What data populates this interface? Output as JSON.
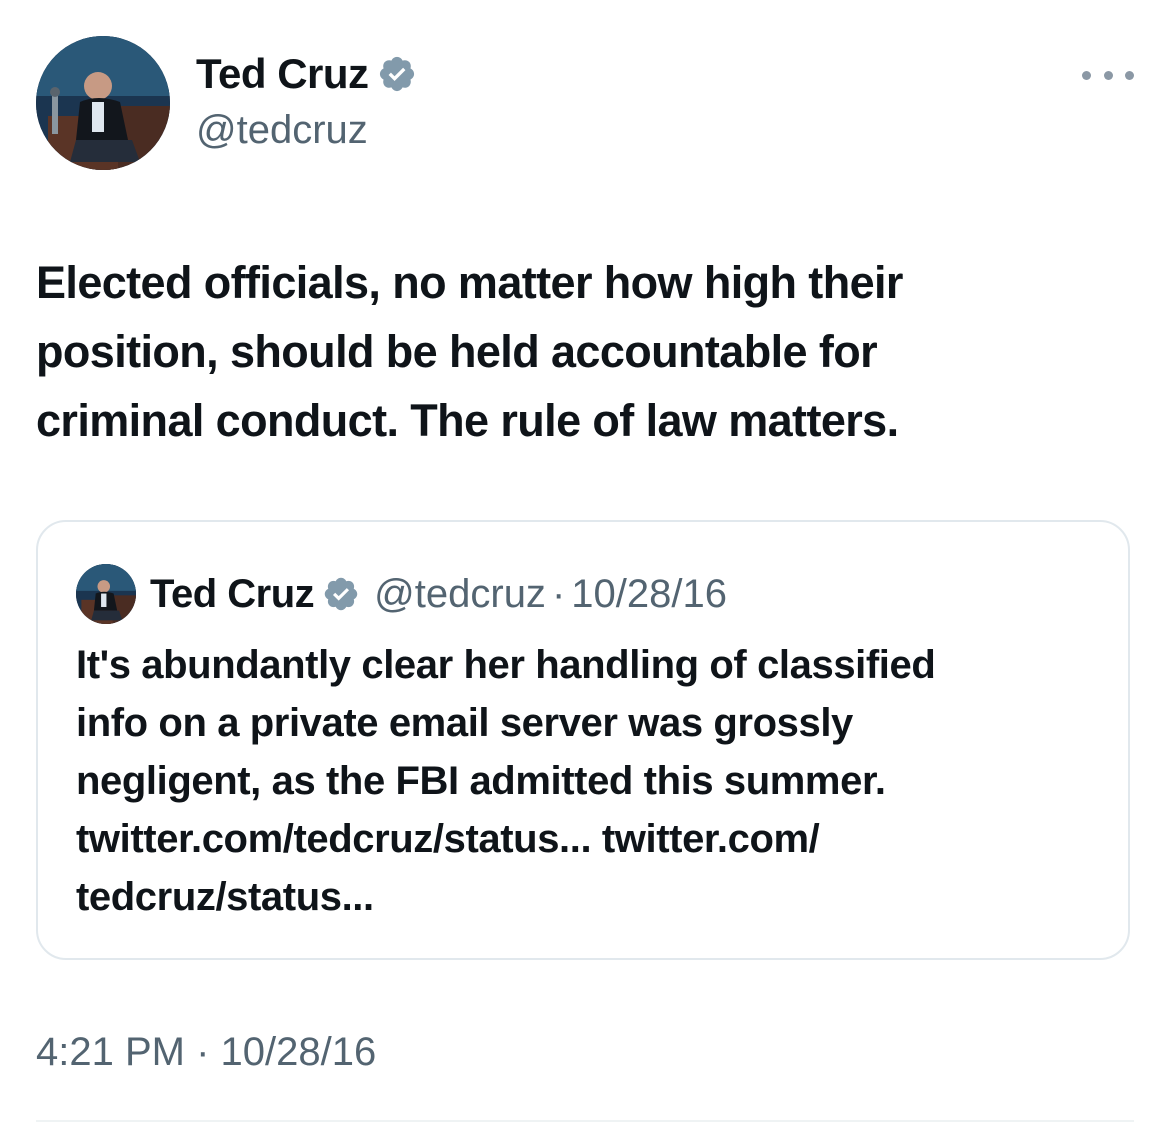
{
  "colors": {
    "text_primary": "#0f1419",
    "text_secondary": "#536471",
    "verified_badge": "#829aab",
    "border": "#e1e8ed"
  },
  "tweet": {
    "author": {
      "display_name": "Ted Cruz",
      "handle": "@tedcruz",
      "verified": true,
      "avatar_icon": "profile-photo"
    },
    "more_icon": "ellipsis-icon",
    "text": "Elected officials, no matter how high their\nposition, should be held accountable for\ncriminal conduct. The rule of law matters.",
    "time": "4:21 PM",
    "separator": "·",
    "date": "10/28/16"
  },
  "quoted": {
    "author": {
      "display_name": "Ted Cruz",
      "handle": "@tedcruz",
      "verified": true
    },
    "separator": "·",
    "date": "10/28/16",
    "text": "It's abundantly clear her handling of classified\ninfo on a private email server was grossly\nnegligent, as the FBI admitted this summer.\ntwitter.com/tedcruz/status... twitter.com/\ntedcruz/status..."
  }
}
